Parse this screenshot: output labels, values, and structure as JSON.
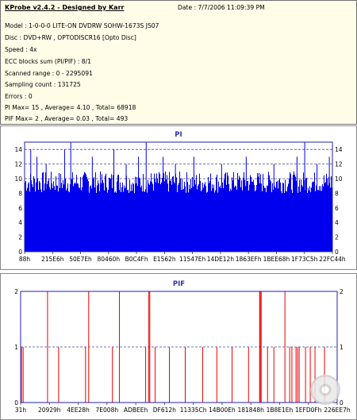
{
  "header": {
    "app_title": "KProbe v2.4.2 - Designed by Karr",
    "date": "Date : 7/7/2006 11:09:39 PM",
    "lines": [
      "Model : 1-0-0-0 LITE-ON DVDRW SOHW-1673S JS07",
      "Disc : DVD+RW , OPTODISCR16 [Opto Disc]",
      "Speed : 4x",
      "ECC blocks sum (PI/PIF) : 8/1",
      "Scanned range : 0 - 2295091",
      "Sampling count : 131725",
      "Errors : 0",
      "PI Max= 15 , Average= 4.10 , Total= 68918",
      "PIF Max= 2 , Average= 0.03 , Total= 493"
    ]
  },
  "chart_data": [
    {
      "type": "bar",
      "title": "PI",
      "color": "#0000ee",
      "ylim": [
        0,
        15
      ],
      "yticks": [
        "0",
        "2",
        "4",
        "6",
        "8",
        "10",
        "12",
        "14"
      ],
      "xticks": [
        "88h",
        "215E6h",
        "50E7Eh",
        "80460h",
        "B0C4Fh",
        "E1562h",
        "11547Eh",
        "14DE12h",
        "1863EFh",
        "1BEE68h",
        "1F73C5h",
        "22FC44h"
      ],
      "baseline_range": [
        8,
        11
      ],
      "spikes": [
        {
          "pos": 0.02,
          "value": 14
        },
        {
          "pos": 0.04,
          "value": 13
        },
        {
          "pos": 0.07,
          "value": 12
        },
        {
          "pos": 0.13,
          "value": 14
        },
        {
          "pos": 0.15,
          "value": 15
        },
        {
          "pos": 0.22,
          "value": 13
        },
        {
          "pos": 0.29,
          "value": 14
        },
        {
          "pos": 0.33,
          "value": 12
        },
        {
          "pos": 0.37,
          "value": 13
        },
        {
          "pos": 0.395,
          "value": 15
        },
        {
          "pos": 0.45,
          "value": 13
        },
        {
          "pos": 0.49,
          "value": 12
        },
        {
          "pos": 0.55,
          "value": 13
        },
        {
          "pos": 0.64,
          "value": 12
        },
        {
          "pos": 0.72,
          "value": 13
        },
        {
          "pos": 0.81,
          "value": 12
        },
        {
          "pos": 0.885,
          "value": 13
        },
        {
          "pos": 0.91,
          "value": 15
        },
        {
          "pos": 0.95,
          "value": 12
        },
        {
          "pos": 0.99,
          "value": 13
        }
      ]
    },
    {
      "type": "bar",
      "title": "PIF",
      "color": "#ee0000",
      "ylim": [
        0,
        2
      ],
      "yticks": [
        "0",
        "1",
        "2"
      ],
      "xticks": [
        "31h",
        "20929h",
        "4EE28h",
        "7E008h",
        "ADBEEh",
        "DF612h",
        "11335Ch",
        "14B00Eh",
        "181848h",
        "1B8E1Eh",
        "1EFD0Fh",
        "226EE7h"
      ],
      "spikes": [
        {
          "pos": 0.003,
          "value": 1
        },
        {
          "pos": 0.008,
          "value": 1
        },
        {
          "pos": 0.085,
          "value": 2
        },
        {
          "pos": 0.12,
          "value": 1
        },
        {
          "pos": 0.205,
          "value": 1
        },
        {
          "pos": 0.215,
          "value": 2
        },
        {
          "pos": 0.29,
          "value": 1
        },
        {
          "pos": 0.312,
          "value": 2
        },
        {
          "pos": 0.395,
          "value": 1
        },
        {
          "pos": 0.405,
          "value": 2
        },
        {
          "pos": 0.408,
          "value": 2
        },
        {
          "pos": 0.425,
          "value": 1
        },
        {
          "pos": 0.47,
          "value": 1
        },
        {
          "pos": 0.52,
          "value": 1
        },
        {
          "pos": 0.575,
          "value": 1
        },
        {
          "pos": 0.62,
          "value": 1
        },
        {
          "pos": 0.668,
          "value": 1
        },
        {
          "pos": 0.72,
          "value": 1
        },
        {
          "pos": 0.755,
          "value": 2
        },
        {
          "pos": 0.757,
          "value": 2
        },
        {
          "pos": 0.76,
          "value": 2
        },
        {
          "pos": 0.78,
          "value": 1
        },
        {
          "pos": 0.8,
          "value": 1
        },
        {
          "pos": 0.835,
          "value": 2
        },
        {
          "pos": 0.85,
          "value": 1
        },
        {
          "pos": 0.857,
          "value": 1
        },
        {
          "pos": 0.87,
          "value": 1
        },
        {
          "pos": 0.875,
          "value": 1
        },
        {
          "pos": 0.88,
          "value": 1
        },
        {
          "pos": 0.9,
          "value": 1
        },
        {
          "pos": 0.915,
          "value": 1
        },
        {
          "pos": 0.93,
          "value": 1
        },
        {
          "pos": 0.96,
          "value": 1
        }
      ]
    }
  ]
}
